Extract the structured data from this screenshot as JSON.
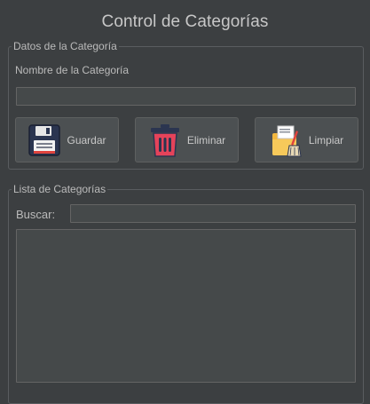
{
  "window": {
    "title": "Control de Categorías"
  },
  "datos": {
    "legend": "Datos de la Categoría",
    "nombre_label": "Nombre de la Categoría",
    "nombre_value": ""
  },
  "buttons": {
    "guardar": {
      "label": "Guardar",
      "icon": "floppy-disk-icon"
    },
    "eliminar": {
      "label": "Eliminar",
      "icon": "trash-can-icon"
    },
    "limpiar": {
      "label": "Limpiar",
      "icon": "folder-broom-icon"
    }
  },
  "lista": {
    "legend": "Lista de Categorías",
    "buscar_label": "Buscar:",
    "buscar_value": "",
    "items": []
  },
  "colors": {
    "background": "#3c3f41",
    "field_background": "#45494a",
    "button_background": "#4c5052",
    "border": "#5a5d60",
    "text": "#bbbbbb"
  }
}
